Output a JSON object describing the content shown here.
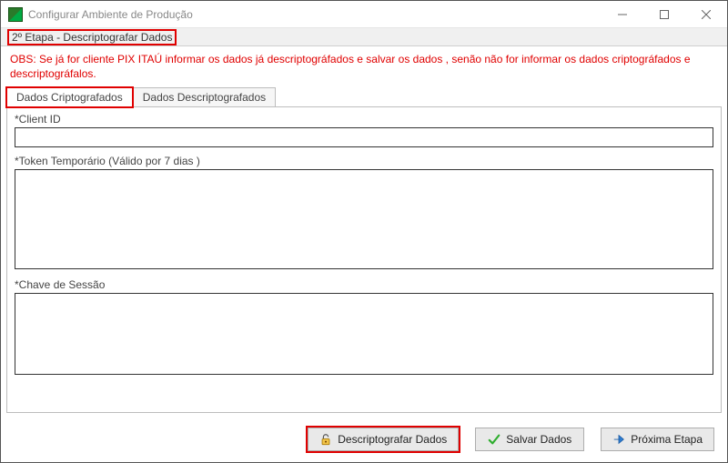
{
  "titlebar": {
    "title": "Configurar Ambiente de Produção"
  },
  "step_banner": "2º  Etapa - Descriptografar Dados",
  "obs": "OBS: Se já for cliente PIX ITAÚ informar os dados já descriptográfados e salvar os dados , senão não for informar os dados criptográfados e descriptográfalos.",
  "tabs": {
    "encrypted": "Dados Criptografados",
    "decrypted": "Dados Descriptografados"
  },
  "fields": {
    "client_id_label": "*Client ID",
    "client_id_value": "",
    "token_label": "*Token Temporário (Válido por 7 dias )",
    "token_value": "",
    "session_key_label": "*Chave de Sessão",
    "session_key_value": ""
  },
  "buttons": {
    "decrypt": "Descriptografar Dados",
    "save": "Salvar Dados",
    "next": "Próxima Etapa"
  }
}
